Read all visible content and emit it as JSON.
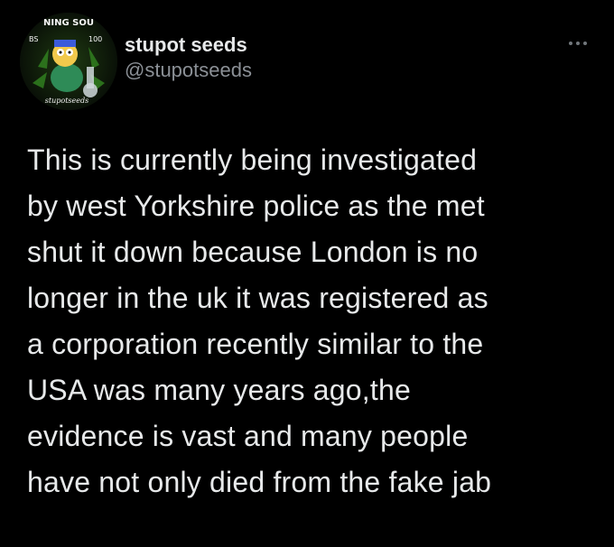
{
  "author": {
    "display_name": "stupot seeds",
    "handle": "@stupotseeds",
    "avatar": {
      "top_text": "NING SOU",
      "left_text": "BS",
      "right_text": "100",
      "bottom_text": "stupotseeds"
    }
  },
  "more_icon": "more-options-icon",
  "tweet": {
    "lines": [
      "This is currently being investigated",
      "by west Yorkshire police as the met",
      "shut it down because London is no",
      "longer in the uk it was registered as",
      "a corporation recently similar to the",
      "USA was many years ago,the",
      "evidence is vast and many people",
      "have not only died from the fake jab"
    ]
  },
  "colors": {
    "background": "#000000",
    "text_primary": "#e7e9ea",
    "text_secondary": "#8b9096"
  }
}
